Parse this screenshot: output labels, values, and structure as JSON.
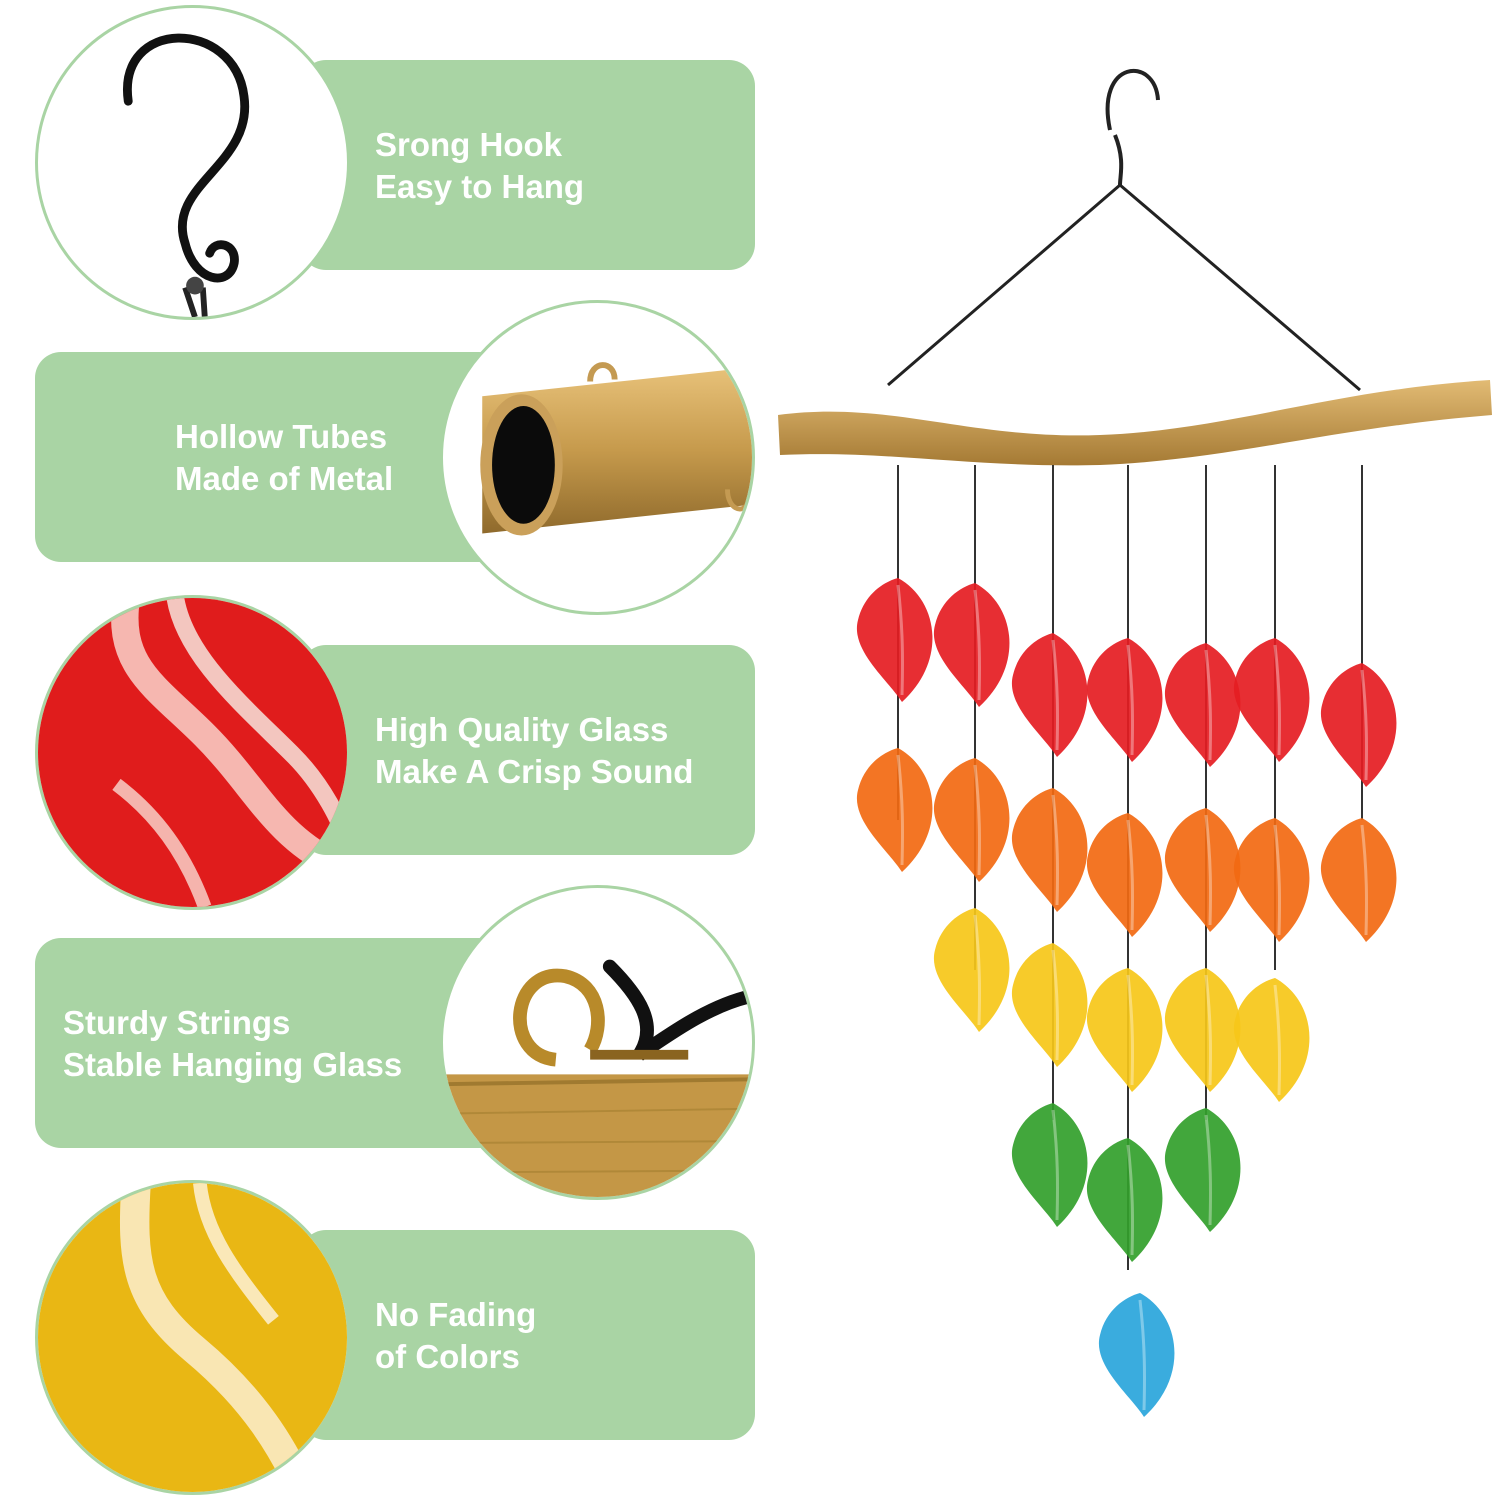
{
  "features": [
    {
      "line1": "Srong Hook",
      "line2": "Easy to Hang",
      "icon": "s-hook-icon"
    },
    {
      "line1": "Hollow Tubes",
      "line2": "Made of Metal",
      "icon": "metal-tube-icon"
    },
    {
      "line1": "High Quality Glass",
      "line2": "Make A Crisp Sound",
      "icon": "red-glass-icon"
    },
    {
      "line1": "Sturdy Strings",
      "line2": "Stable Hanging Glass",
      "icon": "string-knot-icon"
    },
    {
      "line1": "No Fading",
      "line2": "of Colors",
      "icon": "yellow-glass-icon"
    }
  ],
  "colors": {
    "panel": "#a9d4a4",
    "panel_text": "#ffffff",
    "red": "#e51d22",
    "orange": "#f26a12",
    "yellow": "#f7c719",
    "green": "#33a02c",
    "blue": "#2aa6dc",
    "wood": "#c9a05a"
  }
}
